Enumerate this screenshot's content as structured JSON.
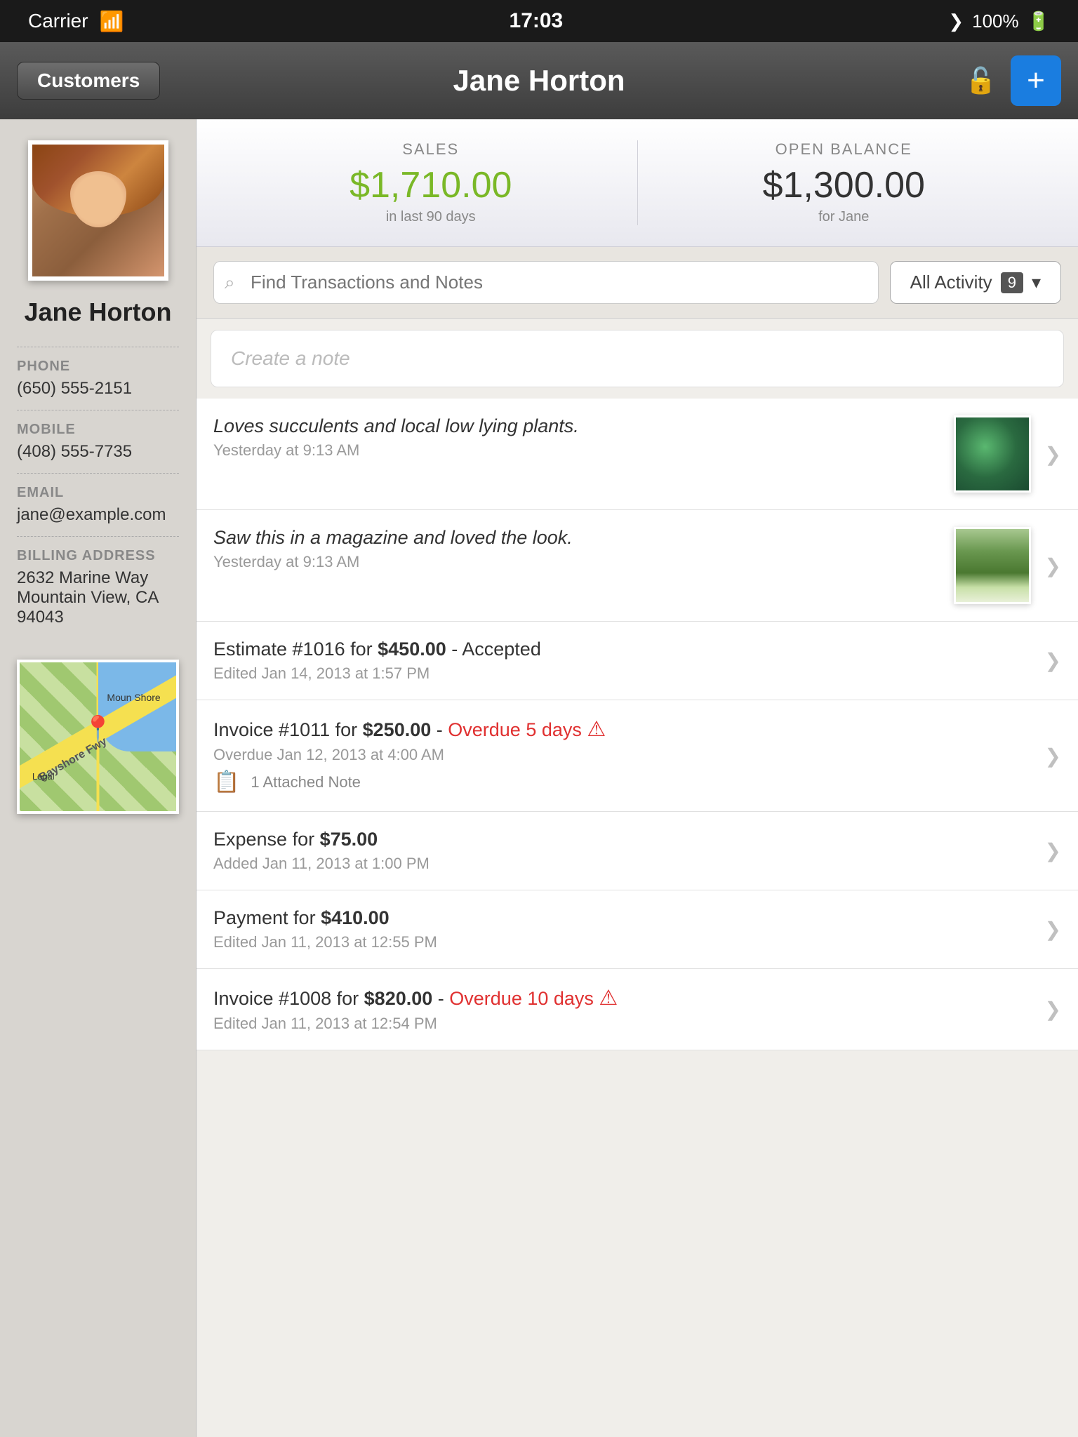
{
  "status_bar": {
    "carrier": "Carrier",
    "time": "17:03",
    "battery": "100%"
  },
  "nav": {
    "back_label": "Customers",
    "title": "Jane Horton",
    "add_label": "+"
  },
  "stats": {
    "sales_label": "SALES",
    "sales_value": "$1,710.00",
    "sales_sub": "in last 90 days",
    "balance_label": "OPEN BALANCE",
    "balance_value": "$1,300.00",
    "balance_sub": "for Jane"
  },
  "search": {
    "placeholder": "Find Transactions and Notes"
  },
  "filter": {
    "label": "All Activity",
    "count": "9"
  },
  "create_note": {
    "placeholder": "Create a note"
  },
  "sidebar": {
    "name": "Jane Horton",
    "phone_label": "PHONE",
    "phone": "(650) 555-2151",
    "mobile_label": "MOBILE",
    "mobile": "(408) 555-7735",
    "email_label": "EMAIL",
    "email": "jane@example.com",
    "address_label": "BILLING ADDRESS",
    "address_line1": "2632 Marine Way",
    "address_line2": "Mountain View, CA 94043"
  },
  "activity": [
    {
      "id": 1,
      "type": "note",
      "title": "Loves succulents and local low lying plants.",
      "subtitle": "Yesterday at 9:13 AM",
      "has_thumb": true,
      "thumb_type": "succulent"
    },
    {
      "id": 2,
      "type": "note",
      "title": "Saw this in a magazine and loved the look.",
      "subtitle": "Yesterday at 9:13 AM",
      "has_thumb": true,
      "thumb_type": "garden"
    },
    {
      "id": 3,
      "type": "estimate",
      "title_prefix": "Estimate #1016 for ",
      "title_bold": "$450.00",
      "title_suffix": " - Accepted",
      "subtitle": "Edited Jan 14, 2013 at 1:57 PM"
    },
    {
      "id": 4,
      "type": "invoice_overdue",
      "title_prefix": "Invoice #1011 for ",
      "title_bold": "$250.00",
      "title_suffix": " - ",
      "overdue_text": "Overdue 5 days",
      "subtitle": "Overdue Jan 12, 2013 at 4:00 AM",
      "attached_note": "1 Attached Note"
    },
    {
      "id": 5,
      "type": "expense",
      "title_prefix": "Expense for ",
      "title_bold": "$75.00",
      "subtitle": "Added Jan 11, 2013 at 1:00 PM"
    },
    {
      "id": 6,
      "type": "payment",
      "title_prefix": "Payment for ",
      "title_bold": "$410.00",
      "subtitle": "Edited Jan 11, 2013 at 12:55 PM"
    },
    {
      "id": 7,
      "type": "invoice_overdue",
      "title_prefix": "Invoice #1008 for ",
      "title_bold": "$820.00",
      "title_suffix": " - ",
      "overdue_text": "Overdue 10 days",
      "subtitle": "Edited Jan 11, 2013 at 12:54 PM"
    }
  ]
}
